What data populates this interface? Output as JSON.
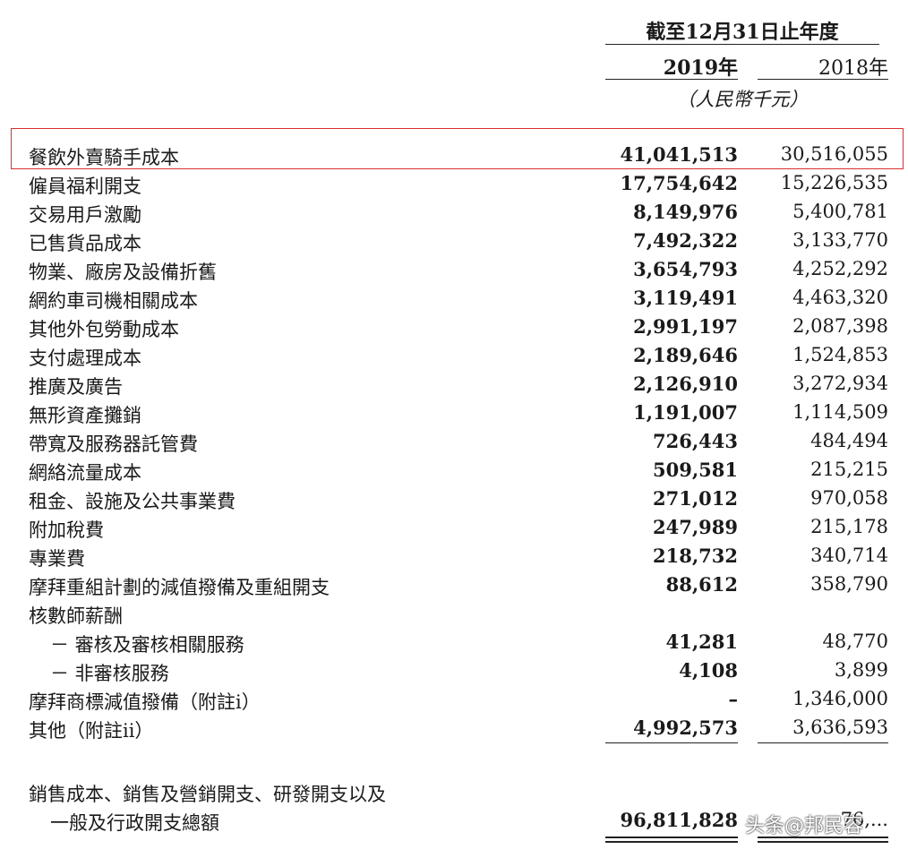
{
  "header": {
    "period": "截至12月31日止年度",
    "year_current": "2019年",
    "year_prior": "2018年",
    "unit": "（人民幣千元）"
  },
  "rows": [
    {
      "label": "餐飲外賣騎手成本",
      "v2019": "41,041,513",
      "v2018": "30,516,055",
      "highlighted": true
    },
    {
      "label": "僱員福利開支",
      "v2019": "17,754,642",
      "v2018": "15,226,535"
    },
    {
      "label": "交易用戶激勵",
      "v2019": "8,149,976",
      "v2018": "5,400,781"
    },
    {
      "label": "已售貨品成本",
      "v2019": "7,492,322",
      "v2018": "3,133,770"
    },
    {
      "label": "物業、廠房及設備折舊",
      "v2019": "3,654,793",
      "v2018": "4,252,292"
    },
    {
      "label": "網約車司機相關成本",
      "v2019": "3,119,491",
      "v2018": "4,463,320"
    },
    {
      "label": "其他外包勞動成本",
      "v2019": "2,991,197",
      "v2018": "2,087,398"
    },
    {
      "label": "支付處理成本",
      "v2019": "2,189,646",
      "v2018": "1,524,853"
    },
    {
      "label": "推廣及廣告",
      "v2019": "2,126,910",
      "v2018": "3,272,934"
    },
    {
      "label": "無形資產攤銷",
      "v2019": "1,191,007",
      "v2018": "1,114,509"
    },
    {
      "label": "帶寬及服務器託管費",
      "v2019": "726,443",
      "v2018": "484,494"
    },
    {
      "label": "網絡流量成本",
      "v2019": "509,581",
      "v2018": "215,215"
    },
    {
      "label": "租金、設施及公共事業費",
      "v2019": "271,012",
      "v2018": "970,058"
    },
    {
      "label": "附加稅費",
      "v2019": "247,989",
      "v2018": "215,178"
    },
    {
      "label": "專業費",
      "v2019": "218,732",
      "v2018": "340,714"
    },
    {
      "label": "摩拜重組計劃的減值撥備及重組開支",
      "v2019": "88,612",
      "v2018": "358,790"
    },
    {
      "label": "核數師薪酬",
      "v2019": "",
      "v2018": ""
    },
    {
      "label": "－ 審核及審核相關服務",
      "v2019": "41,281",
      "v2018": "48,770",
      "indent": true
    },
    {
      "label": "－ 非審核服務",
      "v2019": "4,108",
      "v2018": "3,899",
      "indent": true
    },
    {
      "label": "摩拜商標減值撥備（附註i）",
      "v2019": "–",
      "v2018": "1,346,000"
    },
    {
      "label": "其他（附註ii）",
      "v2019": "4,992,573",
      "v2018": "3,636,593"
    }
  ],
  "total": {
    "label_line1": "銷售成本、銷售及營銷開支、研發開支以及",
    "label_line2": "一般及行政開支總額",
    "v2019": "96,811,828",
    "v2018": "76,..."
  },
  "watermark": "头条@邦民容",
  "colors": {
    "highlight_border": "#d9302f"
  }
}
